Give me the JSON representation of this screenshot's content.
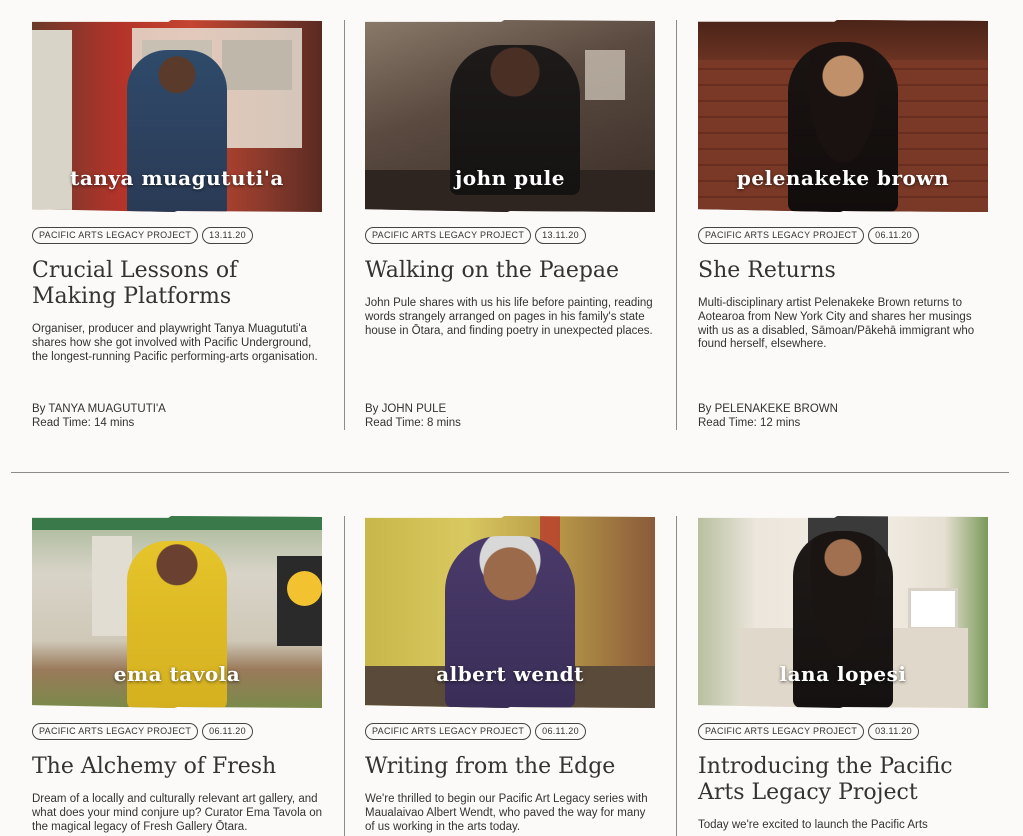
{
  "articles": [
    {
      "name_overlay": "tanya muagututi'a",
      "category": "PACIFIC ARTS LEGACY PROJECT",
      "date": "13.11.20",
      "title": "Crucial Lessons of Making Platforms",
      "description": "Organiser, producer and playwright Tanya Muagututi'a shares how she got involved with Pacific Underground, the longest-running Pacific performing-arts organisation.",
      "author": "By TANYA MUAGUTUTI'A",
      "read_time": "Read Time: 14 mins"
    },
    {
      "name_overlay": "john pule",
      "category": "PACIFIC ARTS LEGACY PROJECT",
      "date": "13.11.20",
      "title": "Walking on the Paepae",
      "description": "John Pule shares with us his life before painting, reading words strangely arranged on pages in his family's state house in Ōtara, and finding poetry in unexpected places.",
      "author": "By JOHN PULE",
      "read_time": "Read Time: 8 mins"
    },
    {
      "name_overlay": "pelenakeke brown",
      "category": "PACIFIC ARTS LEGACY PROJECT",
      "date": "06.11.20",
      "title": "She Returns",
      "description": "Multi-disciplinary artist Pelenakeke Brown returns to Aotearoa from New York City and shares her musings with us as a disabled, Sāmoan/Pākehā immigrant who found herself, elsewhere.",
      "author": "By PELENAKEKE BROWN",
      "read_time": "Read Time: 12 mins"
    },
    {
      "name_overlay": "ema tavola",
      "category": "PACIFIC ARTS LEGACY PROJECT",
      "date": "06.11.20",
      "title": "The Alchemy of Fresh",
      "description": "Dream of a locally and culturally relevant art gallery, and what does your mind conjure up? Curator Ema Tavola on the magical legacy of Fresh Gallery Ōtara.",
      "author": "",
      "read_time": ""
    },
    {
      "name_overlay": "albert wendt",
      "category": "PACIFIC ARTS LEGACY PROJECT",
      "date": "06.11.20",
      "title": "Writing from the Edge",
      "description": "We're thrilled to begin our Pacific Art Legacy series with Maualaivao Albert Wendt, who paved the way for many of us working in the arts today.",
      "author": "",
      "read_time": ""
    },
    {
      "name_overlay": "lana lopesi",
      "category": "PACIFIC ARTS LEGACY PROJECT",
      "date": "03.11.20",
      "title": "Introducing the Pacific Arts Legacy Project",
      "description": "Today we're excited to launch the Pacific Arts",
      "author": "",
      "read_time": ""
    }
  ],
  "photo_colors": [
    "#b23a2c",
    "#5a4a40",
    "#7a3a26",
    "#9c8a62",
    "#c9b24a",
    "#e8e2d8"
  ]
}
